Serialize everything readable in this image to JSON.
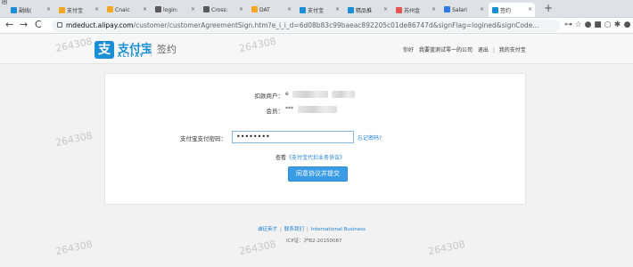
{
  "browser": {
    "top_glyph": "函",
    "tabs": [
      {
        "label": "副线(",
        "color": "#1a8fd6"
      },
      {
        "label": "支付宝",
        "color": "#f5a623"
      },
      {
        "label": "Cnaic",
        "color": "#f5a623"
      },
      {
        "label": "login:",
        "color": "#5a5a5a"
      },
      {
        "label": "Cross:",
        "color": "#5a5a5a"
      },
      {
        "label": "DAT",
        "color": "#f5a623"
      },
      {
        "label": "支付宝",
        "color": "#1a8fd6"
      },
      {
        "label": "精品推",
        "color": "#1a8fd6"
      },
      {
        "label": "苏州金",
        "color": "#e55353"
      },
      {
        "label": "Salari",
        "color": "#2d7be5"
      },
      {
        "label": "签约",
        "color": "#1a8fd6"
      }
    ],
    "tab_close": "×",
    "new_tab": "+",
    "url_host": "mdeduct.alipay.com",
    "url_path": "/customer/customerAgreementSign.htm?e_i_i_d=6d08b83c99baeac892205c01de86747d&signFlag=logined&signCode...",
    "nav_back": "←",
    "nav_forward": "→",
    "nav_reload": "C",
    "extensions": [
      "⊶",
      "☆",
      "●",
      "■",
      "○",
      "✱",
      "●"
    ]
  },
  "header": {
    "logo_glyph": "支",
    "logo_cn": "支付宝",
    "logo_en": "ALIPAY",
    "page_name": "签约",
    "greeting": "你好",
    "company": "我要蓝测试零一的公司",
    "logout": "退出",
    "divider": "|",
    "my_alipay": "我的支付宝"
  },
  "watermark_text": "264308",
  "form": {
    "merchant_label": "扣款商户：",
    "merchant_value_prefix": "e",
    "member_label": "会员：",
    "member_value_prefix": "***",
    "password_label": "支付宝支付密码：",
    "password_value": "••••••••",
    "forgot_link": "忘记密码?",
    "agree_prefix": "查看",
    "agree_link": "《支付宝代扣业务协议》",
    "submit_label": "同意协议并提交"
  },
  "footer": {
    "links": [
      "诚征英才",
      "联系我们",
      "International Business"
    ],
    "separator": "|",
    "icp": "ICP证：沪B2-20150087"
  }
}
